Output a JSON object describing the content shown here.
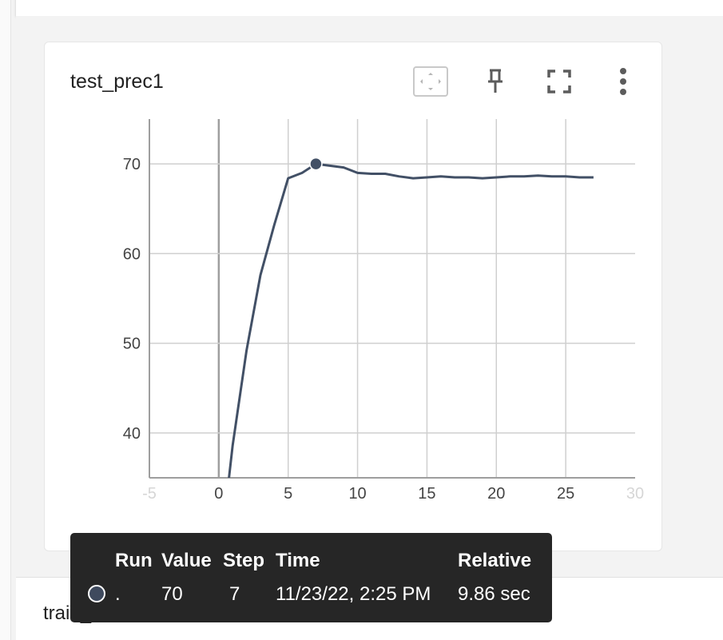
{
  "card": {
    "title": "test_prec1",
    "tools": [
      "fit-domain-icon",
      "pin-icon",
      "fullscreen-icon",
      "more-vert-icon"
    ]
  },
  "next_card_title": "train_acc",
  "chart_data": {
    "type": "line",
    "title": "test_prec1",
    "xlabel": "",
    "ylabel": "",
    "xlim": [
      -5,
      30
    ],
    "ylim": [
      35,
      75
    ],
    "x_ticks": [
      "-5",
      "0",
      "5",
      "10",
      "15",
      "20",
      "25",
      "30"
    ],
    "y_ticks": [
      "40",
      "50",
      "60",
      "70"
    ],
    "grid": true,
    "series": [
      {
        "color": "#425066",
        "x": [
          0,
          1,
          2,
          3,
          4,
          5,
          6,
          7,
          8,
          9,
          10,
          11,
          12,
          13,
          14,
          15,
          16,
          17,
          18,
          19,
          20,
          21,
          22,
          23,
          24,
          25,
          26,
          27
        ],
        "values": [
          25.0,
          38.6,
          49.2,
          57.6,
          63.2,
          68.4,
          69.0,
          70.0,
          69.8,
          69.6,
          69.0,
          68.9,
          68.9,
          68.6,
          68.4,
          68.5,
          68.6,
          68.5,
          68.5,
          68.4,
          68.5,
          68.6,
          68.6,
          68.7,
          68.6,
          68.6,
          68.5,
          68.5
        ]
      }
    ],
    "highlight": {
      "x": 7,
      "y": 70
    }
  },
  "tooltip": {
    "headers": {
      "run": "Run",
      "value": "Value",
      "step": "Step",
      "time": "Time",
      "relative": "Relative"
    },
    "row": {
      "run": ".",
      "value": "70",
      "step": "7",
      "time": "11/23/22, 2:25 PM",
      "relative": "9.86 sec"
    },
    "dot_color": "#3f4a5e"
  }
}
